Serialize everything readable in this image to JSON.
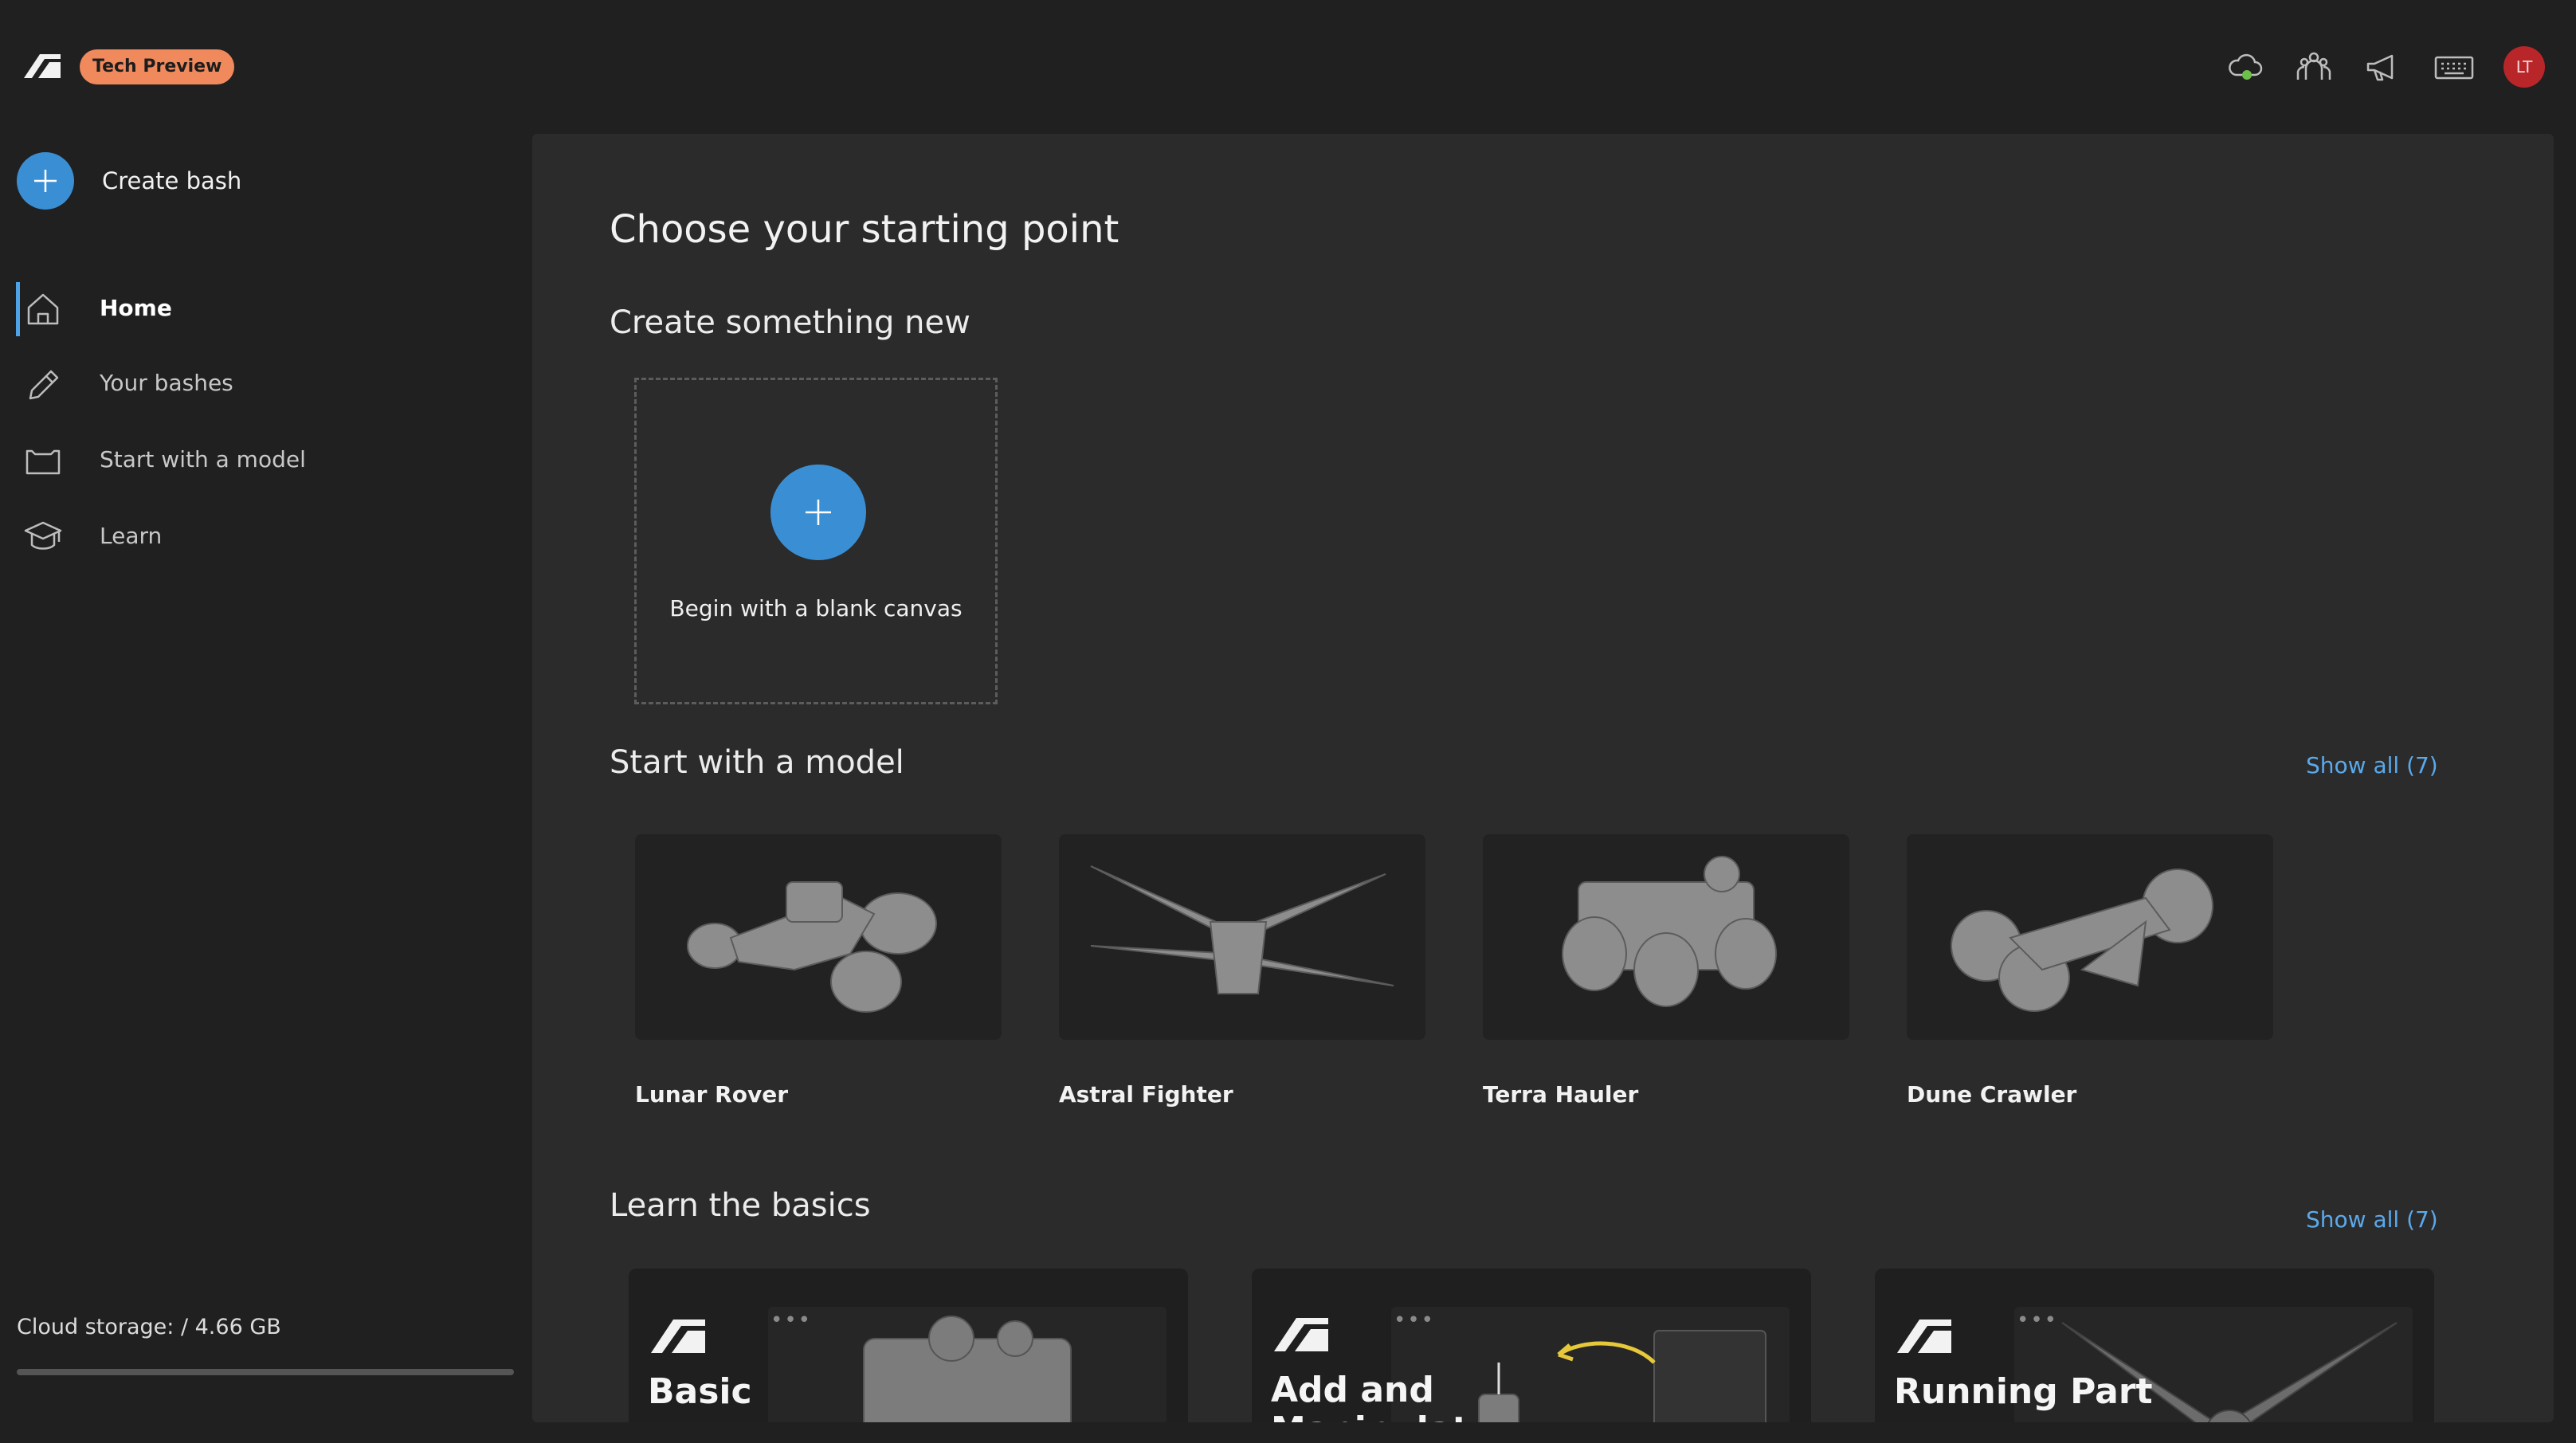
{
  "topbar": {
    "badge": "Tech Preview",
    "icons": [
      "cloud-status-icon",
      "community-icon",
      "announcements-icon",
      "keyboard-shortcuts-icon"
    ],
    "avatar_initials": "LT"
  },
  "sidebar": {
    "create_label": "Create bash",
    "items": [
      {
        "label": "Home",
        "icon": "home-icon",
        "active": true
      },
      {
        "label": "Your bashes",
        "icon": "pencil-icon",
        "active": false
      },
      {
        "label": "Start with a model",
        "icon": "model-box-icon",
        "active": false
      },
      {
        "label": "Learn",
        "icon": "graduation-cap-icon",
        "active": false
      }
    ],
    "storage_label": "Cloud storage: / 4.66 GB"
  },
  "main": {
    "title": "Choose your starting point",
    "new_section": {
      "title": "Create something new",
      "blank_label": "Begin with a blank canvas"
    },
    "models_section": {
      "title": "Start with a model",
      "show_all": "Show all (7)",
      "models": [
        {
          "name": "Lunar Rover"
        },
        {
          "name": "Astral Fighter"
        },
        {
          "name": "Terra Hauler"
        },
        {
          "name": "Dune Crawler"
        }
      ]
    },
    "learn_section": {
      "title": "Learn the basics",
      "show_all": "Show all (7)",
      "cards": [
        {
          "title": "Basic"
        },
        {
          "title": "Add and\nManipulat"
        },
        {
          "title": "Running Part"
        }
      ]
    }
  },
  "colors": {
    "accent": "#3a8fd4",
    "link": "#5aa9ec",
    "badge": "#f08a5d",
    "avatar": "#b8262a",
    "background": "#202020",
    "panel": "#2b2b2b"
  }
}
